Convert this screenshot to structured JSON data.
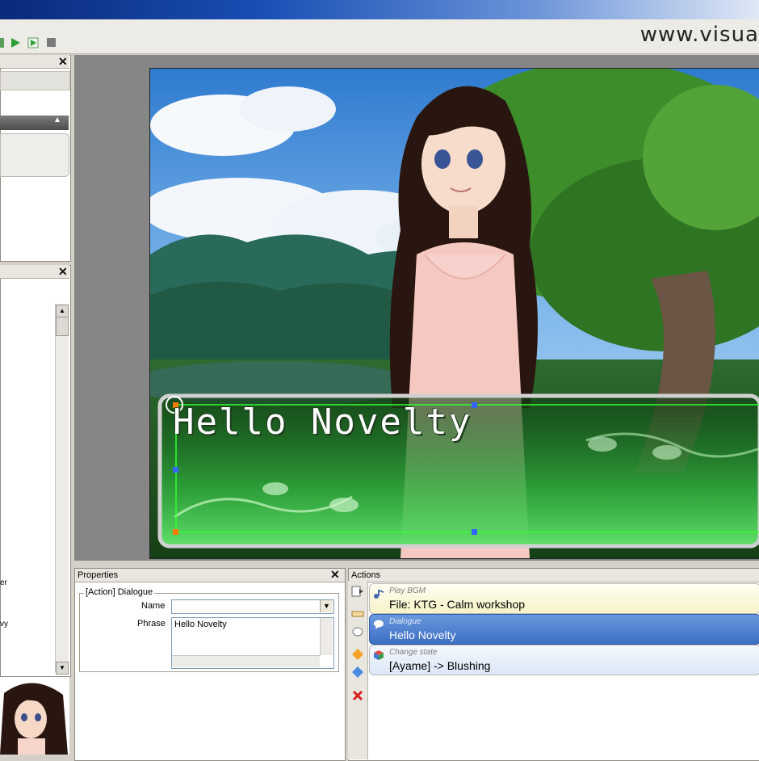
{
  "watermark": "www.visua",
  "properties": {
    "title": "Properties",
    "group": "[Action] Dialogue",
    "name_label": "Name",
    "name_value": "",
    "phrase_label": "Phrase",
    "phrase_value": "Hello Novelty"
  },
  "actions": {
    "title": "Actions",
    "items": [
      {
        "type": "Play BGM",
        "text": "File: KTG - Calm workshop"
      },
      {
        "type": "Dialogue",
        "text": "Hello Novelty"
      },
      {
        "type": "Change state",
        "text": "[Ayame] -> Blushing"
      }
    ]
  },
  "stage": {
    "dialogue_text": "Hello Novelty"
  },
  "left_fragments": {
    "a": "er",
    "b": "vy"
  },
  "colors": {
    "title_start": "#0a2a7a",
    "selected_action": "#3d6fc4",
    "dialogue_box": "#1fa32a"
  }
}
